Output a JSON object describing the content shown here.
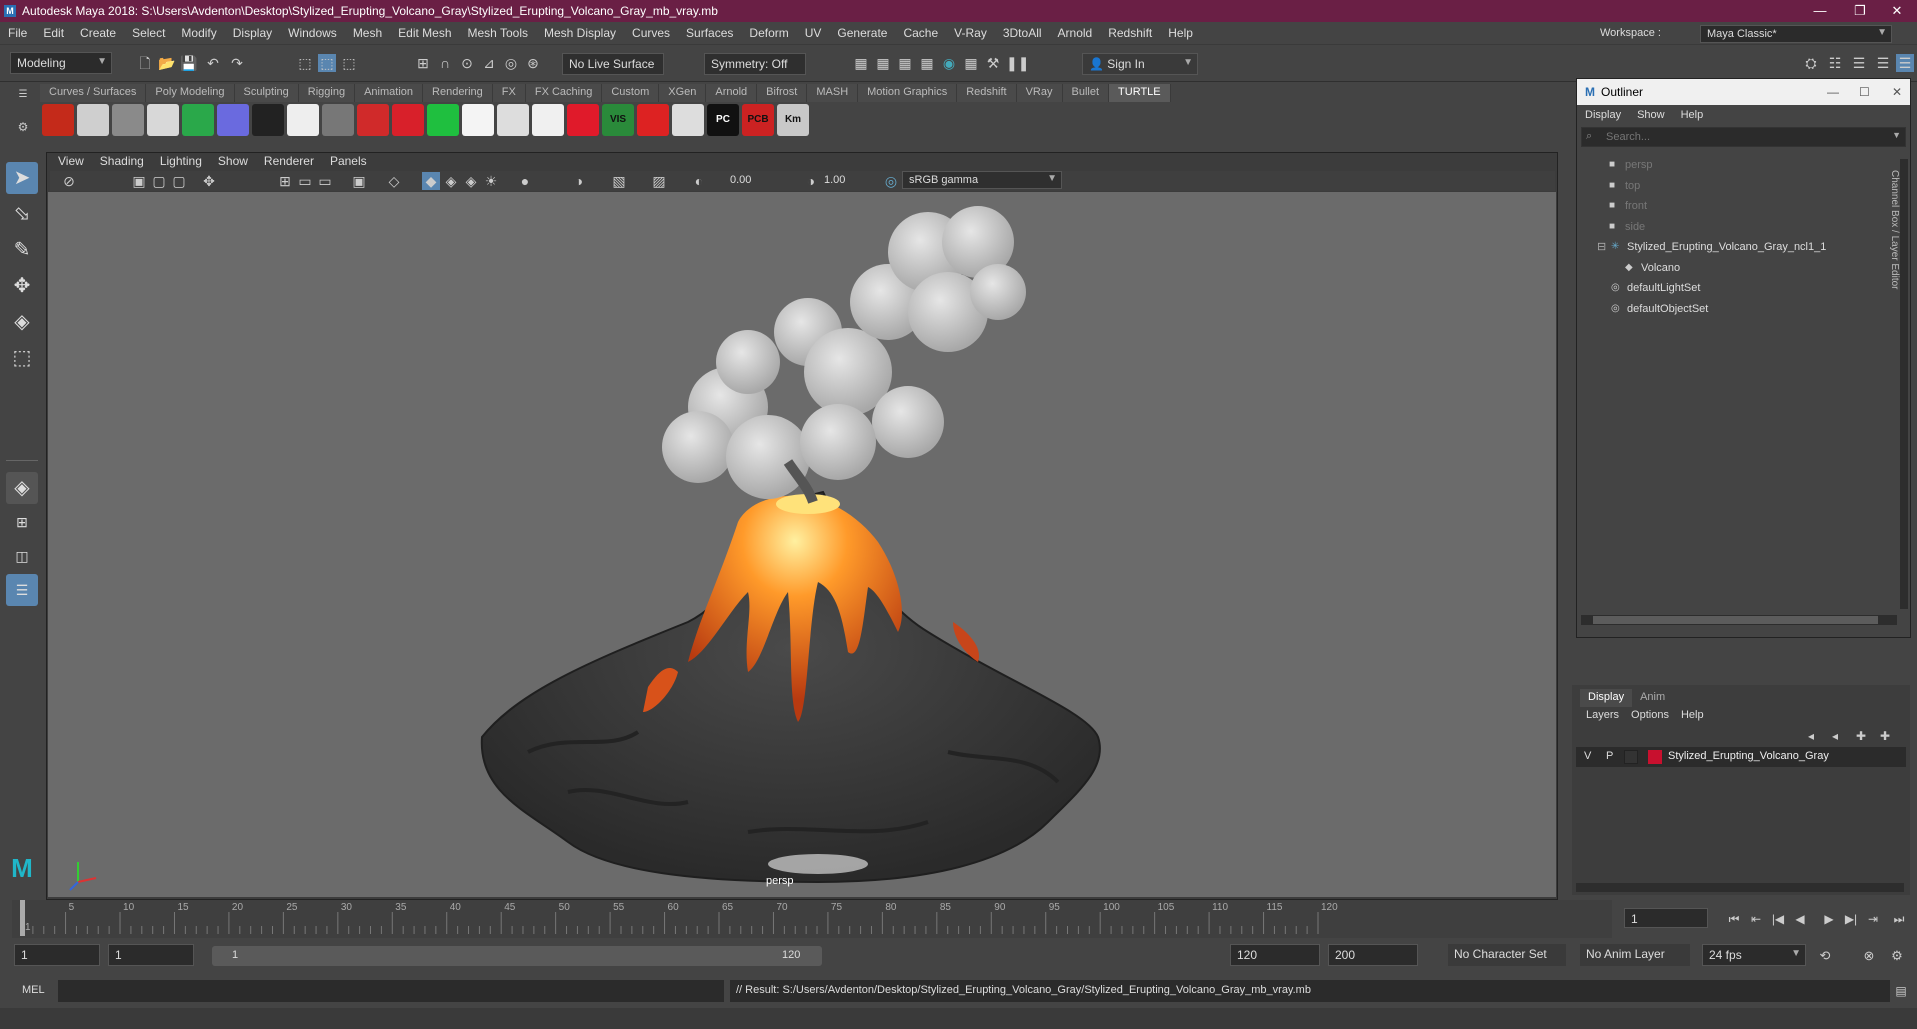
{
  "window": {
    "title": "Autodesk Maya 2018: S:\\Users\\Avdenton\\Desktop\\Stylized_Erupting_Volcano_Gray\\Stylized_Erupting_Volcano_Gray_mb_vray.mb"
  },
  "menubar": [
    "File",
    "Edit",
    "Create",
    "Select",
    "Modify",
    "Display",
    "Windows",
    "Mesh",
    "Edit Mesh",
    "Mesh Tools",
    "Mesh Display",
    "Curves",
    "Surfaces",
    "Deform",
    "UV",
    "Generate",
    "Cache",
    "V-Ray",
    "3DtoAll",
    "Arnold",
    "Redshift",
    "Help"
  ],
  "workspace": {
    "label": "Workspace :",
    "value": "Maya Classic*"
  },
  "statusline": {
    "mode": "Modeling",
    "live_surface": "No Live Surface",
    "symmetry": "Symmetry: Off",
    "sign_in": "Sign In"
  },
  "shelf": {
    "tabs": [
      "Curves / Surfaces",
      "Poly Modeling",
      "Sculpting",
      "Rigging",
      "Animation",
      "Rendering",
      "FX",
      "FX Caching",
      "Custom",
      "XGen",
      "Arnold",
      "Bifrost",
      "MASH",
      "Motion Graphics",
      "Redshift",
      "VRay",
      "Bullet",
      "TURTLE"
    ],
    "active_tab": "TURTLE",
    "icons": [
      {
        "name": "hypershade-icon",
        "color": "#c42a1a"
      },
      {
        "name": "render-sphere-icon",
        "color": "#cfcfcf"
      },
      {
        "name": "sphere-dark-icon",
        "color": "#8a8a8a"
      },
      {
        "name": "sphere-light-icon",
        "color": "#d8d8d8"
      },
      {
        "name": "green-sphere-icon",
        "color": "#2aa84a"
      },
      {
        "name": "grid-cube-icon",
        "color": "#6a6adf"
      },
      {
        "name": "bake-icon",
        "color": "#222222"
      },
      {
        "name": "cloud-icon",
        "color": "#eeeeee"
      },
      {
        "name": "gray-egg-icon",
        "color": "#777777"
      },
      {
        "name": "red-box-icon",
        "color": "#d02a2a"
      },
      {
        "name": "red-box2-icon",
        "color": "#d8202a"
      },
      {
        "name": "green-ball-icon",
        "color": "#1fbf3f"
      },
      {
        "name": "terrain-icon",
        "color": "#f4f4f4"
      },
      {
        "name": "half-sphere-icon",
        "color": "#dddddd"
      },
      {
        "name": "disc-icon",
        "color": "#f0f0f0"
      },
      {
        "name": "red-disc-icon",
        "color": "#e01a2a"
      },
      {
        "name": "vis-icon",
        "color": "#2a8a3a"
      },
      {
        "name": "no-render-icon",
        "color": "#dd2222"
      },
      {
        "name": "bars-icon",
        "color": "#dddddd"
      },
      {
        "name": "pc-icon",
        "color": "#111111"
      },
      {
        "name": "pcb-icon",
        "color": "#cc2222"
      },
      {
        "name": "km-icon",
        "color": "#c8c8c8"
      }
    ],
    "icon_labels": {
      "vis": "VIS",
      "pc": "PC",
      "pcb": "PCB",
      "km": "Km"
    }
  },
  "panel": {
    "menu": [
      "View",
      "Shading",
      "Lighting",
      "Show",
      "Renderer",
      "Panels"
    ],
    "near": "0.00",
    "far": "1.00",
    "color_space": "sRGB gamma",
    "camera_label": "persp"
  },
  "outliner": {
    "title": "Outliner",
    "menu": [
      "Display",
      "Show",
      "Help"
    ],
    "search_placeholder": "Search...",
    "items": [
      {
        "label": "persp",
        "type": "camera",
        "dim": true
      },
      {
        "label": "top",
        "type": "camera",
        "dim": true
      },
      {
        "label": "front",
        "type": "camera",
        "dim": true
      },
      {
        "label": "side",
        "type": "camera",
        "dim": true
      },
      {
        "label": "Stylized_Erupting_Volcano_Gray_ncl1_1",
        "type": "group",
        "dim": false
      },
      {
        "label": "Volcano",
        "type": "mesh",
        "dim": false
      },
      {
        "label": "defaultLightSet",
        "type": "set",
        "dim": false
      },
      {
        "label": "defaultObjectSet",
        "type": "set",
        "dim": false
      }
    ]
  },
  "channel_box_tab": "Channel Box / Layer Editor",
  "layer_editor": {
    "tabs": [
      "Display",
      "Anim"
    ],
    "menu": [
      "Layers",
      "Options",
      "Help"
    ],
    "layer": {
      "v": "V",
      "p": "P",
      "name": "Stylized_Erupting_Volcano_Gray",
      "color": "#c8102e"
    }
  },
  "timeline": {
    "ticks": [
      "1",
      "5",
      "10",
      "15",
      "20",
      "25",
      "30",
      "35",
      "40",
      "45",
      "50",
      "55",
      "60",
      "65",
      "70",
      "75",
      "80",
      "85",
      "90",
      "95",
      "100",
      "105",
      "110",
      "115",
      "120"
    ],
    "current_frame": "1"
  },
  "range": {
    "start": "1",
    "anim_start": "1",
    "range_start": "1",
    "range_end": "120",
    "anim_end": "120",
    "end": "200",
    "character_set": "No Character Set",
    "anim_layer": "No Anim Layer",
    "fps": "24 fps"
  },
  "command": {
    "lang": "MEL",
    "result": "// Result: S:/Users/Avdenton/Desktop/Stylized_Erupting_Volcano_Gray/Stylized_Erupting_Volcano_Gray_mb_vray.mb"
  }
}
